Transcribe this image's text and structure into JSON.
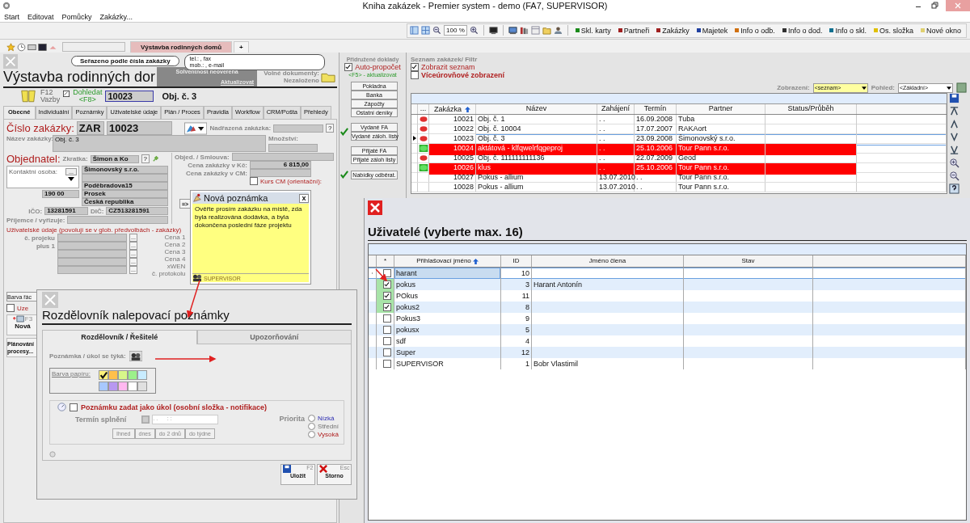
{
  "window": {
    "title": "Kniha zakázek - Premier system - demo (FA7, SUPERVISOR)"
  },
  "menu": [
    "Start",
    "Editovat",
    "Pomůcky",
    "Zakázky..."
  ],
  "toolbar": {
    "zoom": "100 %",
    "buttons": [
      {
        "label": "Skl. karty",
        "color": "#1a8a1a"
      },
      {
        "label": "Partneři",
        "color": "#a02020"
      },
      {
        "label": "Zakázky",
        "color": "#a02020"
      },
      {
        "label": "Majetek",
        "color": "#2040a0"
      },
      {
        "label": "Info o odb.",
        "color": "#d07010"
      },
      {
        "label": "Info o dod.",
        "color": "#303030"
      },
      {
        "label": "Info o skl.",
        "color": "#107090"
      },
      {
        "label": "Os. složka",
        "color": "#e0c000"
      },
      {
        "label": "Nové okno",
        "color": "#e0d070"
      }
    ]
  },
  "doc_tabs": [
    {
      "label": "Výstavba rodinných domů",
      "selected": true
    },
    {
      "label": "+",
      "selected": false
    }
  ],
  "order": {
    "sort_hint": "Seřazeno podle čísla zakázky",
    "contact_bubble": [
      "tel.: , fax",
      "mob.: , e-mail"
    ],
    "title": "Výstavba rodinných dor",
    "solvency": {
      "status": "Solventnost neověřena",
      "action": "Aktualizovat"
    },
    "free_docs": {
      "label": "Volné dokumenty:",
      "value": "Nezaloženo"
    },
    "links": {
      "key": "F12",
      "label": "Vazby"
    },
    "find": {
      "label": "Dohledat",
      "key": "<F8>",
      "value": "10023"
    },
    "order_name": "Obj. č. 3",
    "tabs": [
      {
        "label": "Obecné",
        "selected": true
      },
      {
        "label": "Individuální",
        "selected": false
      },
      {
        "label": "Poznámky",
        "selected": false
      },
      {
        "label": "Uživatelské údaje",
        "selected": false
      },
      {
        "label": "Plán / Proces",
        "selected": false
      },
      {
        "label": "Pravidla",
        "selected": false
      },
      {
        "label": "Workflow",
        "selected": false
      },
      {
        "label": "CRM/Pošta",
        "selected": false
      },
      {
        "label": "Přehledy",
        "selected": false
      }
    ],
    "number": {
      "label": "Číslo zakázky:",
      "prefix": "ZAR",
      "value": "10023"
    },
    "parent": {
      "label": "Nadřazená zakázka:",
      "button": "?"
    },
    "name": {
      "label": "Název zakázky:",
      "value": "Obj. č. 3"
    },
    "quantity": {
      "label": "Množství:"
    },
    "customer": {
      "label": "Objednatel:",
      "short_label": "Zkratka:",
      "short": "Šimon a Ko",
      "help": "?",
      "contact_label": "Kontaktní osoba:",
      "contact_button": "...",
      "zip": "190 00",
      "company": "Šimonovský s.r.o.",
      "address": [
        "Poděbradova15",
        "Prosek",
        "Česká republika"
      ]
    },
    "ico": {
      "label": "IČO:",
      "value": "13281591"
    },
    "dic": {
      "label": "DIČ:",
      "value": "CZ513281591"
    },
    "recipient": {
      "label": "Příjemce / vyřizuje:"
    },
    "contract": {
      "label": "Objed. / Smlouva:"
    },
    "price_czk": {
      "label": "Cena zakázky v Kč:",
      "value": "6 815,00"
    },
    "price_cm": {
      "label": "Cena zakázky v CM:"
    },
    "rate": {
      "label": "Kurs CM (orientační):",
      "checked": false
    },
    "move_button": "=>",
    "user_data": {
      "title": "Uživatelské údaje (povolují se v glob. předvolbách - zakázky)",
      "left": [
        "č. projeku",
        "plus 1"
      ],
      "right": [
        "Cena 1",
        "Cena 2",
        "Cena 3",
        "Cena 4",
        "xWEN",
        "č. protokolu"
      ],
      "browse_button": "..."
    },
    "row_color_button": "Barva řác",
    "closed": {
      "label": "Uze",
      "checked": false
    },
    "new": {
      "key": "F3",
      "label": "Nová"
    },
    "planning": "Plánování procesy..."
  },
  "related_docs": {
    "title": "Přidružené doklady",
    "auto": {
      "label": "Auto-propočet",
      "checked": true
    },
    "refresh": "<F5> - aktualizovat",
    "groups": [
      {
        "done": false,
        "buttons": [
          "Pokladna",
          "Banka",
          "Zápočty",
          "Ostatní deníky"
        ]
      },
      {
        "done": true,
        "buttons": [
          "Vydané FA",
          "Vydané záloh. listy"
        ]
      },
      {
        "done": false,
        "buttons": [
          "Přijaté FA",
          "Přijaté záloh listy"
        ]
      },
      {
        "done": true,
        "buttons": [
          "Nabídky odběrat."
        ]
      }
    ]
  },
  "order_list": {
    "title": "Seznam zakázek/ Filtr",
    "show_list": {
      "label": "Zobrazit seznam",
      "checked": true
    },
    "multilevel": {
      "label": "Víceúrovňové zobrazení",
      "checked": false
    },
    "view_label": "Zobrazení:",
    "view": "<seznam>",
    "look_label": "Pohled:",
    "look": "<Základní>",
    "columns": [
      "...",
      "Zakázka",
      "Název",
      "Zahájení",
      "Termín",
      "Partner",
      "Status/Průběh"
    ],
    "rows": [
      {
        "kind": "pending",
        "number": "10021",
        "name": "Obj. č. 1",
        "start": ". .",
        "due": "16.09.2008",
        "partner": "Tuba",
        "selected": false,
        "highlight": false
      },
      {
        "kind": "pending",
        "number": "10022",
        "name": "Obj. č. 10004",
        "start": ". .",
        "due": "17.07.2007",
        "partner": "RAKAort",
        "selected": false,
        "highlight": false
      },
      {
        "kind": "pending",
        "number": "10023",
        "name": "Obj. č. 3",
        "start": ". .",
        "due": "23.09.2008",
        "partner": "Šimonovský s.r.o.",
        "selected": true,
        "highlight": false
      },
      {
        "kind": "done",
        "number": "10024",
        "name": "aktátová - klfqwelrfqgeproj",
        "start": ". .",
        "due": "25.10.2006",
        "partner": "Tour Pann s.r.o.",
        "selected": false,
        "highlight": true
      },
      {
        "kind": "pending",
        "number": "10025",
        "name": "Obj. č. 111111111136",
        "start": ". .",
        "due": "22.07.2009",
        "partner": "Geod",
        "selected": false,
        "highlight": false
      },
      {
        "kind": "done",
        "number": "10026",
        "name": "klus",
        "start": ". .",
        "due": "25.10.2006",
        "partner": "Tour Pann s.r.o.",
        "selected": false,
        "highlight": true
      },
      {
        "kind": "none",
        "number": "10027",
        "name": "Pokus - allium",
        "start": "13.07.2010",
        "due": ". .",
        "partner": "Tour Pann s.r.o.",
        "selected": false,
        "highlight": false
      },
      {
        "kind": "none",
        "number": "10028",
        "name": "Pokus - allium",
        "start": "13.07.2010",
        "due": ". .",
        "partner": "Tour Pann s.r.o.",
        "selected": false,
        "highlight": false
      }
    ]
  },
  "note": {
    "title": "Nová poznámka",
    "close": "x",
    "text": "Ověřte prosím zakázku na místě, zda byla realizována dodávka, a byla dokončena poslední fáze projektu",
    "author": "SUPERVISOR"
  },
  "distribution": {
    "title": "Rozdělovník nalepovací poznámky",
    "tabs": [
      {
        "label": "Rozdělovník / Řešitelé",
        "selected": true
      },
      {
        "label": "Upozorňování",
        "selected": false
      }
    ],
    "concerns_label": "Poznámka / úkol se týká:",
    "paper_label": "Barva papíru:",
    "paper_colors": [
      {
        "color": "#fff27a",
        "selected": true
      },
      {
        "color": "#ffc04a",
        "selected": false
      },
      {
        "color": "#d8f78a",
        "selected": false
      },
      {
        "color": "#9cf08a",
        "selected": false
      },
      {
        "color": "#c8ecff",
        "selected": false
      },
      {
        "color": "#a8c8ff",
        "selected": false
      },
      {
        "color": "#b898f0",
        "selected": false
      },
      {
        "color": "#ffb8f0",
        "selected": false
      },
      {
        "color": "#ffffff",
        "selected": false
      },
      {
        "color": "#e0e0e0",
        "selected": false
      }
    ],
    "task": {
      "label": "Poznámku zadat jako úkol (osobní složka - notifikace)",
      "checked": false
    },
    "due_label": "Termín splnění",
    "due_value": ". .      : :",
    "quick": [
      "Ihned",
      "dnes",
      "do 2 dnů",
      "do týdne"
    ],
    "priority_label": "Priorita",
    "priorities": [
      {
        "label": "Nízká",
        "kind": "low",
        "selected": false
      },
      {
        "label": "Střední",
        "kind": "medium",
        "selected": false
      },
      {
        "label": "Vysoká",
        "kind": "high",
        "selected": false
      }
    ],
    "save": {
      "key": "F2",
      "label": "Uložit"
    },
    "cancel": {
      "key": "Esc",
      "label": "Storno"
    }
  },
  "users": {
    "title": "Uživatelé (vyberte max. 16)",
    "columns": [
      "*",
      "Přihlašovací jméno",
      "ID",
      "Jméno člena",
      "Stav"
    ],
    "rows": [
      {
        "checked": false,
        "login": "harant",
        "id": "10",
        "selected": true
      },
      {
        "checked": true,
        "login": "pokus",
        "id": "3",
        "name": "Harant Antonín",
        "selected": false
      },
      {
        "checked": true,
        "login": "POkus",
        "id": "11",
        "selected": false
      },
      {
        "checked": true,
        "login": "pokus2",
        "id": "8",
        "selected": false
      },
      {
        "checked": false,
        "login": "Pokus3",
        "id": "9",
        "selected": false
      },
      {
        "checked": false,
        "login": "pokusx",
        "id": "5",
        "selected": false
      },
      {
        "checked": false,
        "login": "sdf",
        "id": "4",
        "selected": false
      },
      {
        "checked": false,
        "login": "Super",
        "id": "12",
        "selected": false
      },
      {
        "checked": false,
        "login": "SUPERVISOR",
        "id": "1",
        "name": "Bobr Vlastimil",
        "selected": false
      }
    ]
  }
}
